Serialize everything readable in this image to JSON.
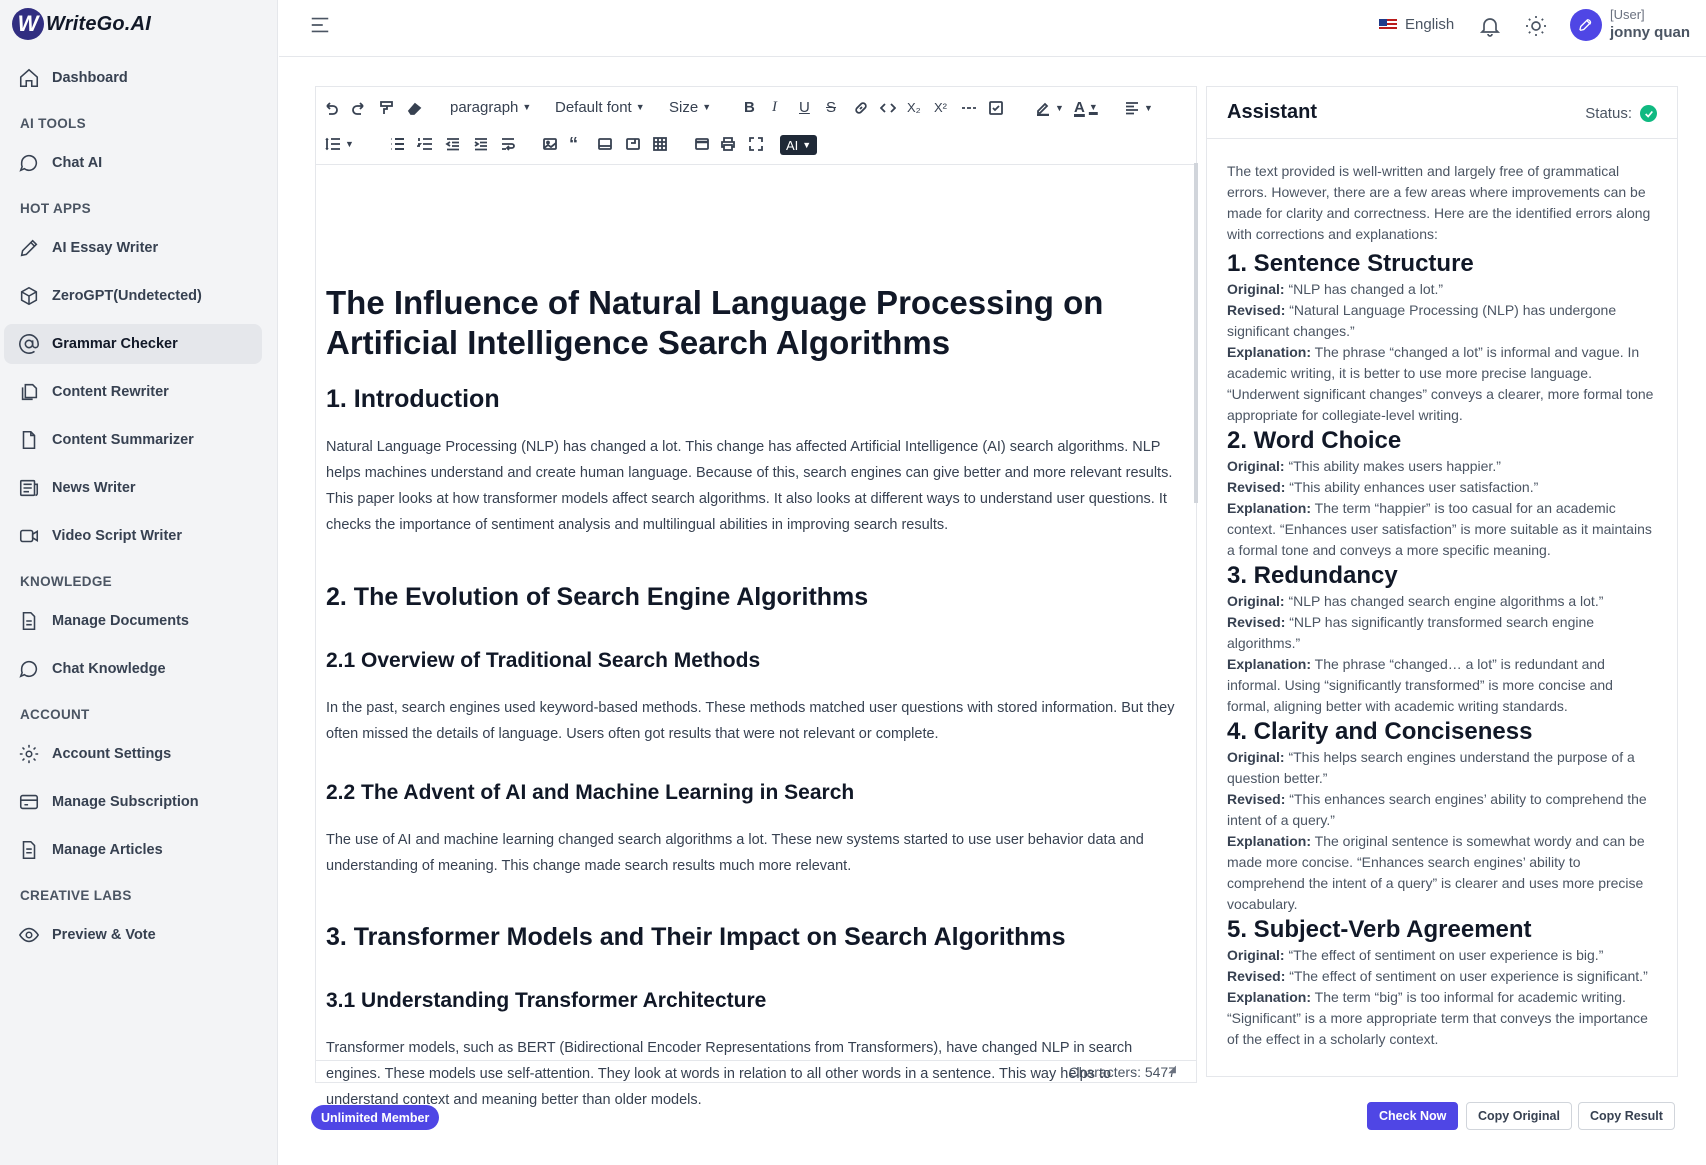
{
  "brand": {
    "logo_letter": "W",
    "name": "WriteGo.AI"
  },
  "sidebar": {
    "dashboard": "Dashboard",
    "sections": {
      "ai_tools": "AI TOOLS",
      "hot_apps": "HOT APPS",
      "knowledge": "KNOWLEDGE",
      "account": "ACCOUNT",
      "creative_labs": "CREATIVE LABS"
    },
    "items": {
      "chat_ai": "Chat AI",
      "essay_writer": "AI Essay Writer",
      "zerogpt": "ZeroGPT(Undetected)",
      "grammar_checker": "Grammar Checker",
      "content_rewriter": "Content Rewriter",
      "content_summarizer": "Content Summarizer",
      "news_writer": "News Writer",
      "video_script_writer": "Video Script Writer",
      "manage_documents": "Manage Documents",
      "chat_knowledge": "Chat Knowledge",
      "account_settings": "Account Settings",
      "manage_subscription": "Manage Subscription",
      "manage_articles": "Manage Articles",
      "preview_vote": "Preview & Vote"
    },
    "active_item": "Grammar Checker"
  },
  "header": {
    "language": "English",
    "user_role": "[User]",
    "user_name": "jonny quan"
  },
  "toolbar": {
    "paragraph": "paragraph",
    "font": "Default font",
    "size": "Size",
    "ai": "AI"
  },
  "document": {
    "title": "The Influence of Natural Language Processing on Artificial Intelligence Search Algorithms",
    "h_intro": "1. Introduction",
    "p_intro": "Natural Language Processing (NLP) has changed a lot. This change has affected Artificial Intelligence (AI) search algorithms. NLP helps machines understand and create human language. Because of this, search engines can give better and more relevant results. This paper looks at how transformer models affect search algorithms. It also looks at different ways to understand user questions. It checks the importance of sentiment analysis and multilingual abilities in improving search results.",
    "h_evolution": "2. The Evolution of Search Engine Algorithms",
    "h_2_1": "2.1 Overview of Traditional Search Methods",
    "p_2_1": "In the past, search engines used keyword-based methods. These methods matched user questions with stored information. But they often missed the details of language. Users often got results that were not relevant or complete.",
    "h_2_2": "2.2 The Advent of AI and Machine Learning in Search",
    "p_2_2": "The use of AI and machine learning changed search algorithms a lot. These new systems started to use user behavior data and understanding of meaning. This change made search results much more relevant.",
    "h_transformers": "3. Transformer Models and Their Impact on Search Algorithms",
    "h_3_1": "3.1 Understanding Transformer Architecture",
    "p_3_1": "Transformer models, such as BERT (Bidirectional Encoder Representations from Transformers), have changed NLP in search engines. These models use self-attention. They look at words in relation to all other words in a sentence. This way helps to understand context and meaning better than older models."
  },
  "editor_status": {
    "characters": "Characters: 5477"
  },
  "assistant": {
    "title": "Assistant",
    "status_label": "Status:",
    "intro": "The text provided is well-written and largely free of grammatical errors. However, there are a few areas where improvements can be made for clarity and correctness. Here are the identified errors along with corrections and explanations:",
    "labels": {
      "original": "Original:",
      "revised": "Revised:",
      "explanation": "Explanation:"
    },
    "items": [
      {
        "heading": "1. Sentence Structure",
        "original": "“NLP has changed a lot.”",
        "revised": "“Natural Language Processing (NLP) has undergone significant changes.”",
        "explanation": "The phrase “changed a lot” is informal and vague. In academic writing, it is better to use more precise language. “Underwent significant changes” conveys a clearer, more formal tone appropriate for collegiate-level writing."
      },
      {
        "heading": "2. Word Choice",
        "original": "“This ability makes users happier.”",
        "revised": "“This ability enhances user satisfaction.”",
        "explanation": "The term “happier” is too casual for an academic context. “Enhances user satisfaction” is more suitable as it maintains a formal tone and conveys a more specific meaning."
      },
      {
        "heading": "3. Redundancy",
        "original": "“NLP has changed search engine algorithms a lot.”",
        "revised": "“NLP has significantly transformed search engine algorithms.”",
        "explanation": "The phrase “changed… a lot” is redundant and informal. Using “significantly transformed” is more concise and formal, aligning better with academic writing standards."
      },
      {
        "heading": "4. Clarity and Conciseness",
        "original": "“This helps search engines understand the purpose of a question better.”",
        "revised": "“This enhances search engines’ ability to comprehend the intent of a query.”",
        "explanation": "The original sentence is somewhat wordy and can be made more concise. “Enhances search engines’ ability to comprehend the intent of a query” is clearer and uses more precise vocabulary."
      },
      {
        "heading": "5. Subject-Verb Agreement",
        "original": "“The effect of sentiment on user experience is big.”",
        "revised": "“The effect of sentiment on user experience is significant.”",
        "explanation": "The term “big” is too informal for academic writing. “Significant” is a more appropriate term that conveys the importance of the effect in a scholarly context."
      }
    ]
  },
  "footer": {
    "badge": "Unlimited Member",
    "check_now": "Check Now",
    "copy_original": "Copy Original",
    "copy_result": "Copy Result"
  },
  "colors": {
    "accent": "#4f46e5",
    "status_ok": "#10b981",
    "sidebar_bg": "#f3f4f6"
  }
}
